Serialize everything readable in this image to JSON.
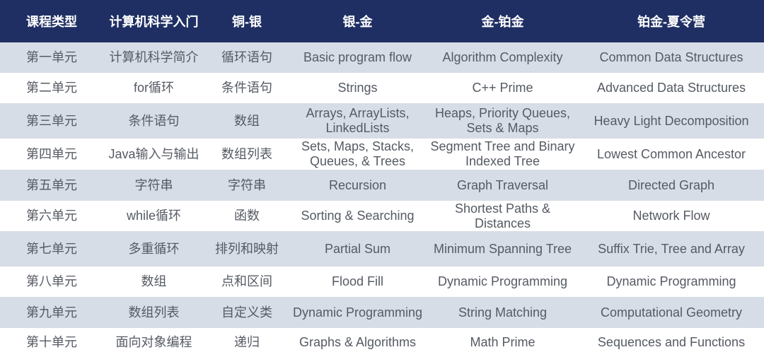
{
  "table": {
    "headers": [
      "课程类型",
      "计算机科学入门",
      "铜-银",
      "银-金",
      "金-铂金",
      "铂金-夏令营"
    ],
    "rows": [
      [
        "第一单元",
        "计算机科学简介",
        "循环语句",
        "Basic program flow",
        "Algorithm Complexity",
        "Common Data Structures"
      ],
      [
        "第二单元",
        "for循环",
        "条件语句",
        "Strings",
        "C++ Prime",
        "Advanced Data Structures"
      ],
      [
        "第三单元",
        "条件语句",
        "数组",
        "Arrays, ArrayLists, LinkedLists",
        "Heaps, Priority Queues, Sets & Maps",
        "Heavy Light Decomposition"
      ],
      [
        "第四单元",
        "Java输入与输出",
        "数组列表",
        "Sets, Maps, Stacks, Queues, & Trees",
        "Segment Tree and Binary Indexed Tree",
        "Lowest Common Ancestor"
      ],
      [
        "第五单元",
        "字符串",
        "字符串",
        "Recursion",
        "Graph Traversal",
        "Directed Graph"
      ],
      [
        "第六单元",
        "while循环",
        "函数",
        "Sorting & Searching",
        "Shortest Paths & Distances",
        "Network Flow"
      ],
      [
        "第七单元",
        "多重循环",
        "排列和映射",
        "Partial Sum",
        "Minimum Spanning Tree",
        "Suffix Trie, Tree and Array"
      ],
      [
        "第八单元",
        "数组",
        "点和区间",
        "Flood Fill",
        "Dynamic Programming",
        "Dynamic Programming"
      ],
      [
        "第九单元",
        "数组列表",
        "自定义类",
        "Dynamic Programming",
        "String Matching",
        "Computational Geometry"
      ],
      [
        "第十单元",
        "面向对象编程",
        "递归",
        "Graphs & Algorithms",
        "Math Prime",
        "Sequences and Functions"
      ]
    ]
  },
  "colors": {
    "header_bg": "#1f2f63",
    "shaded_row": "#d7dde6",
    "text": "#555a63"
  }
}
